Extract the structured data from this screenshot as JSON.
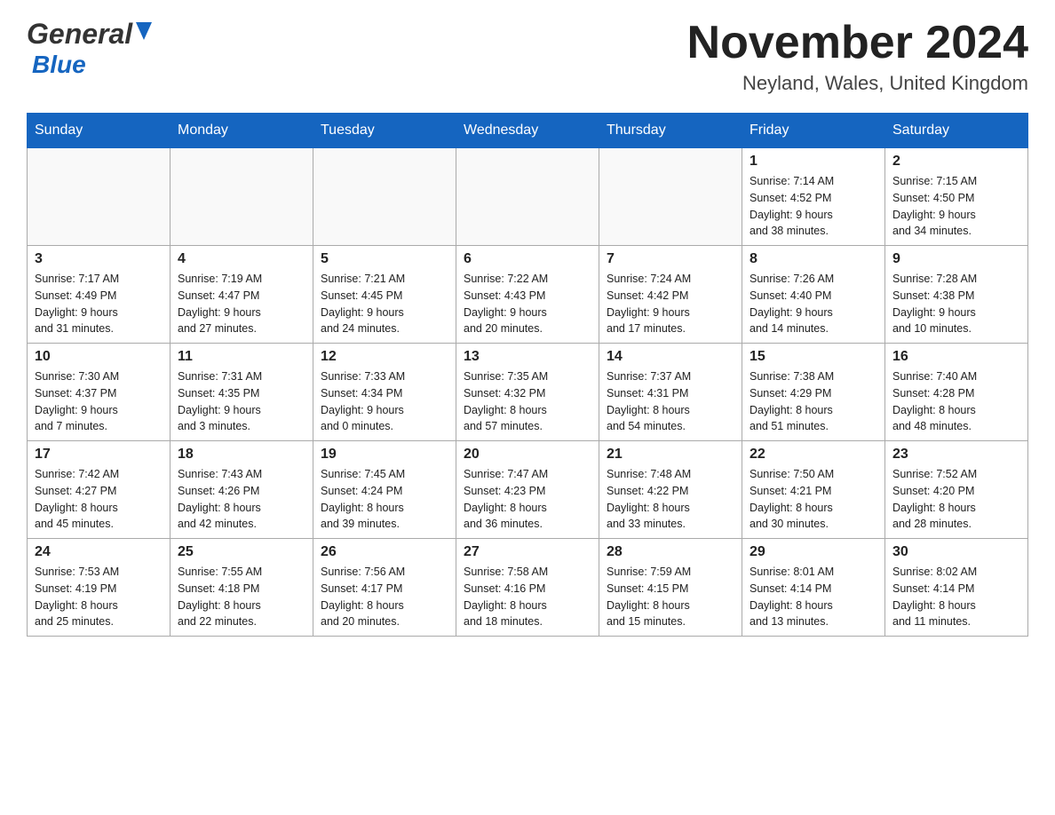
{
  "header": {
    "logo_general": "General",
    "logo_blue": "Blue",
    "month_title": "November 2024",
    "location": "Neyland, Wales, United Kingdom"
  },
  "weekdays": [
    "Sunday",
    "Monday",
    "Tuesday",
    "Wednesday",
    "Thursday",
    "Friday",
    "Saturday"
  ],
  "weeks": [
    [
      {
        "day": "",
        "info": ""
      },
      {
        "day": "",
        "info": ""
      },
      {
        "day": "",
        "info": ""
      },
      {
        "day": "",
        "info": ""
      },
      {
        "day": "",
        "info": ""
      },
      {
        "day": "1",
        "info": "Sunrise: 7:14 AM\nSunset: 4:52 PM\nDaylight: 9 hours\nand 38 minutes."
      },
      {
        "day": "2",
        "info": "Sunrise: 7:15 AM\nSunset: 4:50 PM\nDaylight: 9 hours\nand 34 minutes."
      }
    ],
    [
      {
        "day": "3",
        "info": "Sunrise: 7:17 AM\nSunset: 4:49 PM\nDaylight: 9 hours\nand 31 minutes."
      },
      {
        "day": "4",
        "info": "Sunrise: 7:19 AM\nSunset: 4:47 PM\nDaylight: 9 hours\nand 27 minutes."
      },
      {
        "day": "5",
        "info": "Sunrise: 7:21 AM\nSunset: 4:45 PM\nDaylight: 9 hours\nand 24 minutes."
      },
      {
        "day": "6",
        "info": "Sunrise: 7:22 AM\nSunset: 4:43 PM\nDaylight: 9 hours\nand 20 minutes."
      },
      {
        "day": "7",
        "info": "Sunrise: 7:24 AM\nSunset: 4:42 PM\nDaylight: 9 hours\nand 17 minutes."
      },
      {
        "day": "8",
        "info": "Sunrise: 7:26 AM\nSunset: 4:40 PM\nDaylight: 9 hours\nand 14 minutes."
      },
      {
        "day": "9",
        "info": "Sunrise: 7:28 AM\nSunset: 4:38 PM\nDaylight: 9 hours\nand 10 minutes."
      }
    ],
    [
      {
        "day": "10",
        "info": "Sunrise: 7:30 AM\nSunset: 4:37 PM\nDaylight: 9 hours\nand 7 minutes."
      },
      {
        "day": "11",
        "info": "Sunrise: 7:31 AM\nSunset: 4:35 PM\nDaylight: 9 hours\nand 3 minutes."
      },
      {
        "day": "12",
        "info": "Sunrise: 7:33 AM\nSunset: 4:34 PM\nDaylight: 9 hours\nand 0 minutes."
      },
      {
        "day": "13",
        "info": "Sunrise: 7:35 AM\nSunset: 4:32 PM\nDaylight: 8 hours\nand 57 minutes."
      },
      {
        "day": "14",
        "info": "Sunrise: 7:37 AM\nSunset: 4:31 PM\nDaylight: 8 hours\nand 54 minutes."
      },
      {
        "day": "15",
        "info": "Sunrise: 7:38 AM\nSunset: 4:29 PM\nDaylight: 8 hours\nand 51 minutes."
      },
      {
        "day": "16",
        "info": "Sunrise: 7:40 AM\nSunset: 4:28 PM\nDaylight: 8 hours\nand 48 minutes."
      }
    ],
    [
      {
        "day": "17",
        "info": "Sunrise: 7:42 AM\nSunset: 4:27 PM\nDaylight: 8 hours\nand 45 minutes."
      },
      {
        "day": "18",
        "info": "Sunrise: 7:43 AM\nSunset: 4:26 PM\nDaylight: 8 hours\nand 42 minutes."
      },
      {
        "day": "19",
        "info": "Sunrise: 7:45 AM\nSunset: 4:24 PM\nDaylight: 8 hours\nand 39 minutes."
      },
      {
        "day": "20",
        "info": "Sunrise: 7:47 AM\nSunset: 4:23 PM\nDaylight: 8 hours\nand 36 minutes."
      },
      {
        "day": "21",
        "info": "Sunrise: 7:48 AM\nSunset: 4:22 PM\nDaylight: 8 hours\nand 33 minutes."
      },
      {
        "day": "22",
        "info": "Sunrise: 7:50 AM\nSunset: 4:21 PM\nDaylight: 8 hours\nand 30 minutes."
      },
      {
        "day": "23",
        "info": "Sunrise: 7:52 AM\nSunset: 4:20 PM\nDaylight: 8 hours\nand 28 minutes."
      }
    ],
    [
      {
        "day": "24",
        "info": "Sunrise: 7:53 AM\nSunset: 4:19 PM\nDaylight: 8 hours\nand 25 minutes."
      },
      {
        "day": "25",
        "info": "Sunrise: 7:55 AM\nSunset: 4:18 PM\nDaylight: 8 hours\nand 22 minutes."
      },
      {
        "day": "26",
        "info": "Sunrise: 7:56 AM\nSunset: 4:17 PM\nDaylight: 8 hours\nand 20 minutes."
      },
      {
        "day": "27",
        "info": "Sunrise: 7:58 AM\nSunset: 4:16 PM\nDaylight: 8 hours\nand 18 minutes."
      },
      {
        "day": "28",
        "info": "Sunrise: 7:59 AM\nSunset: 4:15 PM\nDaylight: 8 hours\nand 15 minutes."
      },
      {
        "day": "29",
        "info": "Sunrise: 8:01 AM\nSunset: 4:14 PM\nDaylight: 8 hours\nand 13 minutes."
      },
      {
        "day": "30",
        "info": "Sunrise: 8:02 AM\nSunset: 4:14 PM\nDaylight: 8 hours\nand 11 minutes."
      }
    ]
  ]
}
